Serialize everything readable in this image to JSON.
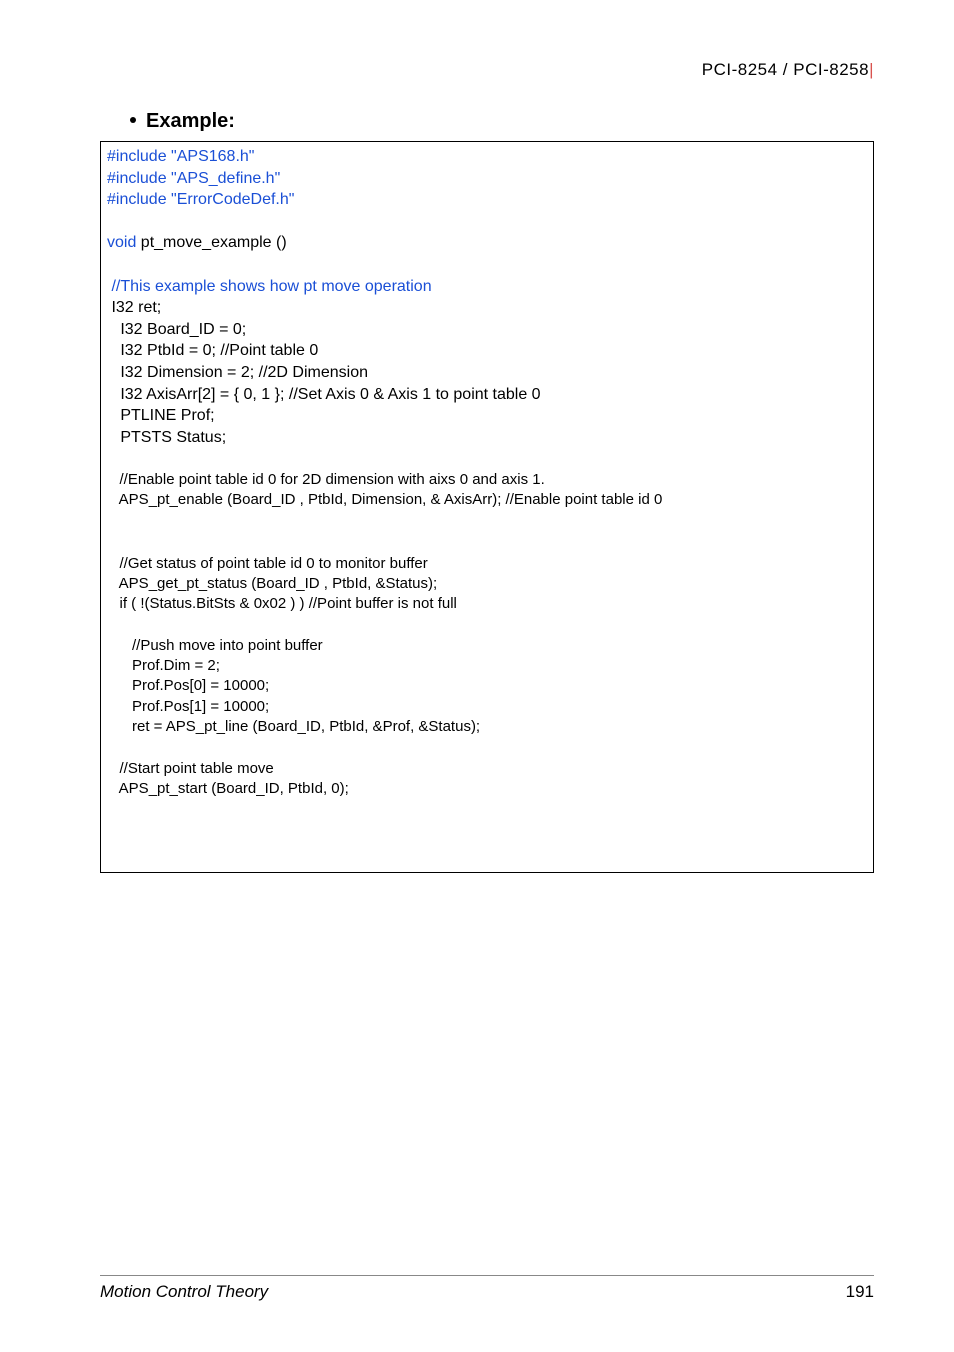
{
  "header": {
    "left": "PCI-8254 / PCI-8258",
    "accent": "|"
  },
  "example_label": "Example:",
  "code": {
    "l01": "#include \"APS168.h\"",
    "l02": "#include \"APS_define.h\"",
    "l03": "#include \"ErrorCodeDef.h\"",
    "l04": "void",
    "l04b": " pt_move_example ()",
    "l05": " //This example shows how pt move operation",
    "l06": " I32 ret;",
    "l07": "   I32 Board_ID = 0;",
    "l08": "   I32 PtbId = 0; //Point table 0",
    "l09": "   I32 Dimension = 2; //2D Dimension",
    "l10": "   I32 AxisArr[2] = { 0, 1 }; //Set Axis 0 & Axis 1 to point table 0",
    "l11": "   PTLINE Prof;",
    "l12": "   PTSTS Status;",
    "l13": "   //Enable point table id 0 for 2D dimension with aixs 0 and axis 1.",
    "l14": "   APS_pt_enable (Board_ID , PtbId, Dimension, & AxisArr); //Enable point table id 0",
    "l15": "   //Get status of point table id 0 to monitor buffer",
    "l16": "   APS_get_pt_status (Board_ID , PtbId, &Status);",
    "l17": "   if ( !(Status.BitSts & 0x02 ) ) //Point buffer is not full",
    "l18": "      //Push move into point buffer",
    "l19": "      Prof.Dim = 2;",
    "l20": "      Prof.Pos[0] = 10000;",
    "l21": "      Prof.Pos[1] = 10000;",
    "l22": "      ret = APS_pt_line (Board_ID, PtbId, &Prof, &Status);",
    "l23": "   //Start point table move",
    "l24": "   APS_pt_start (Board_ID, PtbId, 0);"
  },
  "footer": {
    "left": "Motion Control Theory",
    "right": "191"
  }
}
